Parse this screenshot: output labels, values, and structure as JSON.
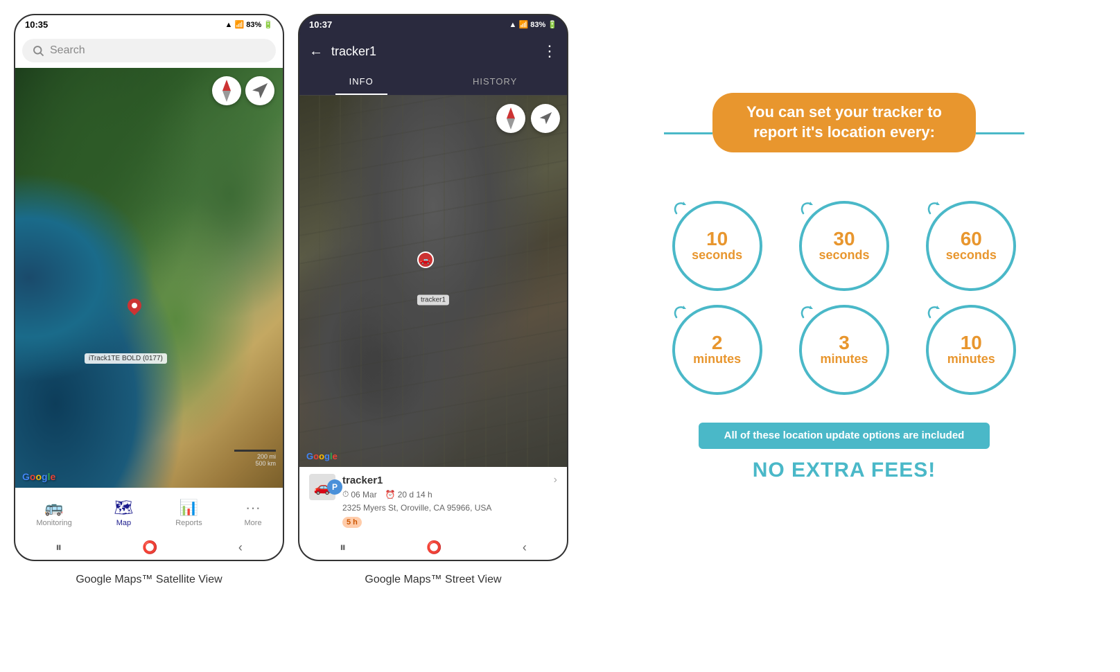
{
  "phone1": {
    "status_time": "10:35",
    "status_icons": "▲ .ul 83%",
    "search_placeholder": "Search",
    "map_label": "iTrack1TE BOLD (0177)",
    "scale_label1": "200 mi",
    "scale_label2": "500 km",
    "google_logo": "Google",
    "nav_items": [
      {
        "icon": "🚌",
        "label": "Monitoring",
        "active": false
      },
      {
        "icon": "🗺",
        "label": "Map",
        "active": true
      },
      {
        "icon": "📊",
        "label": "Reports",
        "active": false
      },
      {
        "icon": "•••",
        "label": "More",
        "active": false
      }
    ],
    "caption": "Google Maps™ Satellite View"
  },
  "phone2": {
    "status_time": "10:37",
    "status_icons": "▲ .ul 83%",
    "header_title": "tracker1",
    "tab_info": "INFO",
    "tab_history": "HISTORY",
    "google_logo": "Google",
    "tracker": {
      "name": "tracker1",
      "date": "06 Mar",
      "duration": "20 d 14 h",
      "address": "2325 Myers St, Oroville, CA 95966, USA",
      "time_badge": "5 h",
      "car_label": "tracker1"
    },
    "caption": "Google Maps™ Street View"
  },
  "info_panel": {
    "header_text": "You can set your tracker to report it's location every:",
    "circles": [
      {
        "num": "10",
        "unit": "seconds"
      },
      {
        "num": "30",
        "unit": "seconds"
      },
      {
        "num": "60",
        "unit": "seconds"
      },
      {
        "num": "2",
        "unit": "minutes"
      },
      {
        "num": "3",
        "unit": "minutes"
      },
      {
        "num": "10",
        "unit": "minutes"
      }
    ],
    "included_text": "All of these location update options are included",
    "no_fees_text": "NO EXTRA FEES!"
  }
}
